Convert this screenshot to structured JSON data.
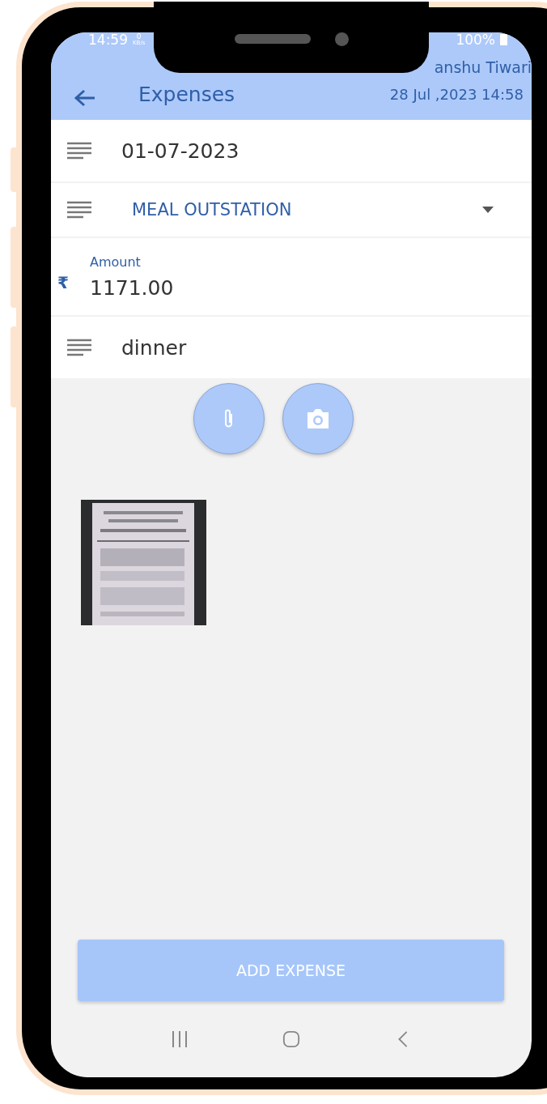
{
  "status_bar": {
    "time": "14:59",
    "speed_value": "0",
    "speed_unit": "KB/s",
    "battery": "100%"
  },
  "header": {
    "title": "Expenses",
    "user": "anshu Tiwari",
    "datetime": "28 Jul ,2023 14:58"
  },
  "fields": [
    {
      "kind": "text",
      "value": "01-07-2023"
    },
    {
      "kind": "dropdown",
      "value": "MEAL OUTSTATION"
    },
    {
      "kind": "amount",
      "label": "Amount",
      "currency": "₹",
      "value": "1171.00"
    },
    {
      "kind": "text",
      "value": "dinner"
    }
  ],
  "submit": {
    "label": "ADD EXPENSE"
  }
}
